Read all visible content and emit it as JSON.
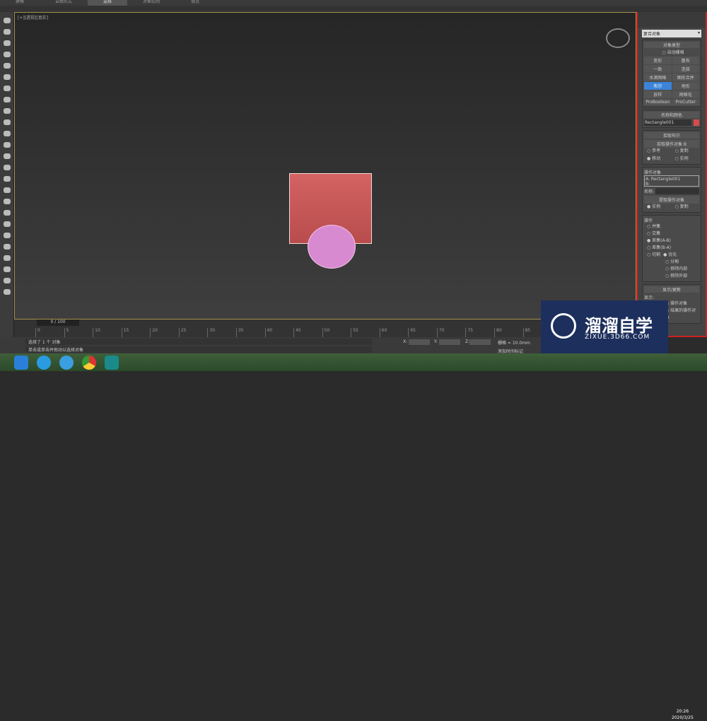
{
  "ribbon_tabs": [
    {
      "label": "建模"
    },
    {
      "label": "自由形式"
    },
    {
      "label": "选择",
      "active": true
    },
    {
      "label": "对象绘制"
    },
    {
      "label": "填充"
    }
  ],
  "viewport": {
    "label": "[+][透视][真实]"
  },
  "right_panel": {
    "dropdown": "复合对象",
    "object_type": {
      "title": "对象类型",
      "auto_grid": "自动栅格",
      "buttons": [
        "变形",
        "散布",
        "一致",
        "连接",
        "水滴网格",
        "图形合并",
        "布尔",
        "地形",
        "放样",
        "网格化",
        "ProBoolean",
        "ProCutter"
      ],
      "active": "布尔"
    },
    "name_color": {
      "title": "名称和颜色",
      "name": "Rectangle001",
      "color": "#d94c4c"
    },
    "pick_boolean": {
      "title": "拾取布尔",
      "pick_button": "拾取操作对象 B",
      "options": [
        "参考",
        "复制",
        "移动",
        "实例"
      ],
      "selected": "移动"
    },
    "operands": {
      "title": "操作对象",
      "list": [
        "A: Rectangle001",
        "B:"
      ],
      "name_label": "名称:",
      "extract_button": "提取操作对象",
      "options": [
        "实例",
        "复制"
      ],
      "selected": "实例"
    },
    "operation": {
      "title": "操作",
      "options": [
        "并集",
        "交集",
        "差集(A-B)",
        "差集(B-A)",
        "切割"
      ],
      "selected": "差集(A-B)",
      "cut_options": [
        "优化",
        "分割",
        "移除内部",
        "移除外部"
      ],
      "cut_selected": "优化"
    },
    "display_update": {
      "title": "显示/更新",
      "display_label": "显示:",
      "options": [
        "操作对象",
        "结果的操作对象"
      ]
    }
  },
  "timeline": {
    "frame": "0 / 100",
    "ticks": [
      "0",
      "5",
      "10",
      "15",
      "20",
      "25",
      "30",
      "35",
      "40",
      "45",
      "50",
      "55",
      "60",
      "65",
      "70",
      "75",
      "80",
      "85"
    ]
  },
  "status": {
    "selection": "选择了 1 个 对象",
    "prompt": "单击或单击并拖动以选择对象",
    "x_label": "X:",
    "y_label": "Y:",
    "z_label": "Z:",
    "grid": "栅格 = 10.0mm",
    "add_time_tag": "添加时间标记"
  },
  "watermark": {
    "title": "溜溜自学",
    "url": "ZIXUE.3D66.COM"
  },
  "taskbar": {
    "time": "20:26",
    "date": "2020/3/25"
  }
}
